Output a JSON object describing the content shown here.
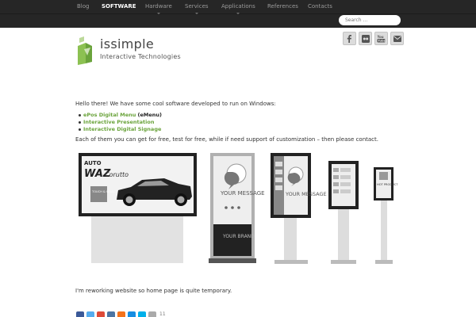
{
  "nav": {
    "items": [
      {
        "label": "Blog",
        "active": false
      },
      {
        "label": "SOFTWARE",
        "active": true
      },
      {
        "label": "Hardware",
        "active": false
      },
      {
        "label": "Services",
        "active": false
      },
      {
        "label": "Applications",
        "active": false
      },
      {
        "label": "References",
        "active": false
      },
      {
        "label": "Contacts",
        "active": false
      }
    ],
    "search_placeholder": "Search ..."
  },
  "logo": {
    "name": "issimple",
    "tagline": "Interactive Technologies"
  },
  "social": [
    "facebook-icon",
    "flickr-icon",
    "youtube-icon",
    "email-icon"
  ],
  "content": {
    "intro": "Hello there! We have some cool software developed to run on Windows:",
    "products": [
      {
        "label": "ePos Digital Menu",
        "note": "(eMenu)"
      },
      {
        "label": "Interactive Presentation",
        "note": ""
      },
      {
        "label": "Interactive Digital Signage",
        "note": ""
      }
    ],
    "paragraph": "Each of them you can get for free, test for free, while if need support of customization – then please contact.",
    "rework": "I'm reworking website so home page is quite temporary."
  },
  "illustration": {
    "billboard": {
      "brand_top": "AUTO",
      "brand_main": "WAZ",
      "model": "Corutto",
      "touch": "TOUCH & SELECT"
    },
    "kiosk_large": {
      "message": "YOUR MESSAGE",
      "brand": "YOUR BRAND"
    },
    "kiosk_medium": {
      "message": "YOUR MESSAGE"
    },
    "kiosk_small": {
      "text": "HOT PRODUCT"
    }
  },
  "share": {
    "count": "11",
    "icons": [
      "facebook-share-icon",
      "twitter-share-icon",
      "google-plus-share-icon",
      "vk-share-icon",
      "odnoklassniki-share-icon",
      "mail-share-icon",
      "livejournal-share-icon",
      "more-share-icon"
    ],
    "colors": [
      "#3b5998",
      "#55acee",
      "#dd4b39",
      "#4c75a3",
      "#f4731c",
      "#168de2",
      "#00b0ea",
      "#aaaaaa"
    ]
  },
  "colors": {
    "accent": "#6aa33b",
    "topbar": "#262626"
  }
}
